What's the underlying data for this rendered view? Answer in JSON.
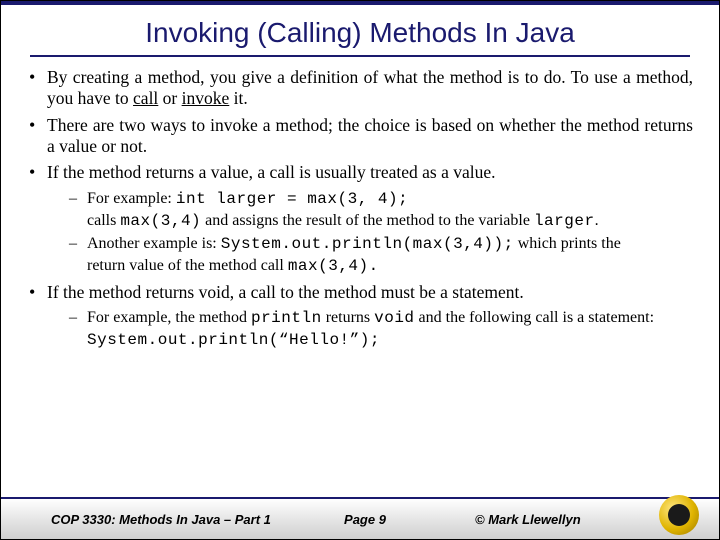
{
  "title": "Invoking (Calling) Methods In Java",
  "bullets": {
    "b1_a": "By creating a method, you give a definition of what the method is to do. To use a method, you have to ",
    "b1_call": "call",
    "b1_or": " or ",
    "b1_invoke": "invoke",
    "b1_end": " it.",
    "b2": "There are two ways to invoke a method; the choice is based on whether the method returns a value or not.",
    "b3": "If the method returns a value, a call is usually treated as a value.",
    "b4": "If the method returns void, a call to the method must be a statement."
  },
  "sub1": {
    "s1_a": "For example: ",
    "s1_code": "int larger = max(3, 4);",
    "s1_line2a": " calls ",
    "s1_line2code": "max(3,4)",
    "s1_line2b": " and assigns the result of the method to the variable ",
    "s1_line2var": "larger",
    "s1_line2end": ".",
    "s2_a": "Another example is: ",
    "s2_code": "System.out.println(max(3,4));",
    "s2_b": " which prints the",
    "s2_line2a": "return value of the method call ",
    "s2_line2code": "max(3,4).",
    "s2_line2end": ""
  },
  "sub2": {
    "s1_a": "For example, the method ",
    "s1_code1": "println",
    "s1_b": " returns ",
    "s1_code2": "void",
    "s1_c": " and the following call is a statement:",
    "s1_codeline": "System.out.println(“Hello!”);"
  },
  "footer": {
    "left": "COP 3330: Methods In Java – Part 1",
    "center": "Page 9",
    "right": "© Mark Llewellyn"
  }
}
